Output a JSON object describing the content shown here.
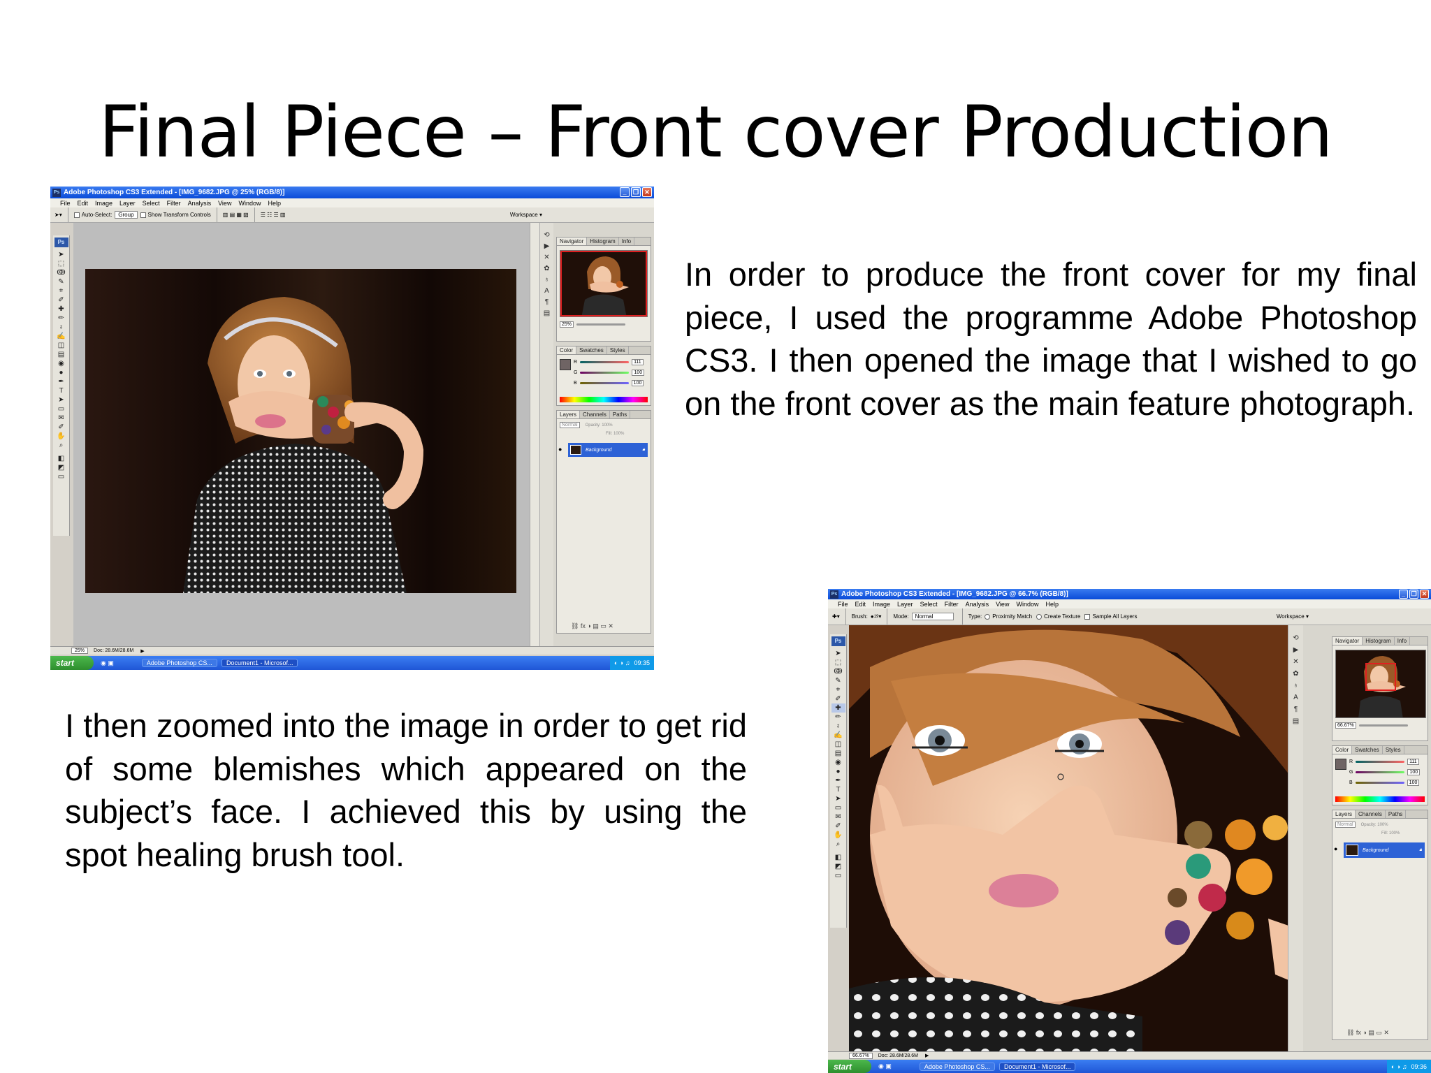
{
  "slide": {
    "title": "Final Piece – Front cover Production",
    "paragraph1": "In order to produce the front cover for my final piece, I used the programme Adobe Photoshop CS3. I then opened the image that I wished to go on the front cover as the main feature photograph.",
    "paragraph2": "I then zoomed into the image in order to get rid of some blemishes which appeared on the subject’s face. I achieved this by using the spot healing brush tool."
  },
  "ps1": {
    "title": "Adobe Photoshop CS3 Extended - [IMG_9682.JPG @ 25% (RGB/8)]",
    "menu": [
      "File",
      "Edit",
      "Image",
      "Layer",
      "Select",
      "Filter",
      "Analysis",
      "View",
      "Window",
      "Help"
    ],
    "options": {
      "auto_select_label": "Auto-Select:",
      "auto_select_value": "Group",
      "transform_label": "Show Transform Controls",
      "workspace_label": "Workspace ▾"
    },
    "panels": {
      "navigator_tabs": [
        "Navigator",
        "Histogram",
        "Info"
      ],
      "zoom_value": "25%",
      "color_tabs": [
        "Color",
        "Swatches",
        "Styles"
      ],
      "color_values": [
        "111",
        "100",
        "100"
      ],
      "layers_tabs": [
        "Layers",
        "Channels",
        "Paths"
      ],
      "layers_blend": "Normal",
      "layers_opacity": "Opacity: 100%",
      "layers_fill": "Fill: 100%",
      "layer_name": "Background"
    },
    "status": {
      "zoom": "25%",
      "doc": "Doc: 28.6M/28.6M"
    },
    "taskbar": {
      "start": "start",
      "items": [
        "Adobe Photoshop CS...",
        "Document1 - Microsof..."
      ],
      "clock": "09:35"
    }
  },
  "ps2": {
    "title": "Adobe Photoshop CS3 Extended - [IMG_9682.JPG @ 66.7% (RGB/8)]",
    "menu": [
      "File",
      "Edit",
      "Image",
      "Layer",
      "Select",
      "Filter",
      "Analysis",
      "View",
      "Window",
      "Help"
    ],
    "options": {
      "brush_label": "Brush:",
      "brush_size": "19",
      "mode_label": "Mode:",
      "mode_value": "Normal",
      "type_label": "Type:",
      "type_option1": "Proximity Match",
      "type_option2": "Create Texture",
      "sample_label": "Sample All Layers",
      "workspace_label": "Workspace ▾"
    },
    "panels": {
      "navigator_tabs": [
        "Navigator",
        "Histogram",
        "Info"
      ],
      "zoom_value": "66.67%",
      "color_tabs": [
        "Color",
        "Swatches",
        "Styles"
      ],
      "color_values": [
        "111",
        "100",
        "100"
      ],
      "layers_tabs": [
        "Layers",
        "Channels",
        "Paths"
      ],
      "layers_blend": "Normal",
      "layers_opacity": "Opacity: 100%",
      "layers_fill": "Fill: 100%",
      "layer_name": "Background"
    },
    "status": {
      "zoom": "66.67%",
      "doc": "Doc: 28.6M/28.6M"
    },
    "taskbar": {
      "start": "start",
      "items": [
        "Adobe Photoshop CS...",
        "Document1 - Microsof..."
      ],
      "clock": "09:36"
    }
  },
  "icons": {
    "toolbox": [
      "move-icon",
      "marquee-icon",
      "lasso-icon",
      "quick-select-icon",
      "crop-icon",
      "eyedropper-icon",
      "healing-brush-icon",
      "brush-icon",
      "clone-stamp-icon",
      "history-brush-icon",
      "eraser-icon",
      "gradient-icon",
      "blur-icon",
      "dodge-icon",
      "pen-icon",
      "type-icon",
      "path-select-icon",
      "shape-icon",
      "notes-icon",
      "eyedropper2-icon",
      "hand-icon",
      "zoom-icon"
    ],
    "glyphs": [
      "➤",
      "⬚",
      "ↂ",
      "✎",
      "⌗",
      "✐",
      "✚",
      "✏",
      "♁",
      "✍",
      "◫",
      "▤",
      "◉",
      "●",
      "✒",
      "T",
      "➤",
      "▭",
      "✉",
      "✐",
      "✋",
      "⌕"
    ]
  },
  "colors": {
    "xp_blue": "#0a4bd8",
    "ps_gray": "#d4d0c8",
    "layer_selected": "#2d62d6",
    "xp_start_green": "#2e8e2e"
  }
}
